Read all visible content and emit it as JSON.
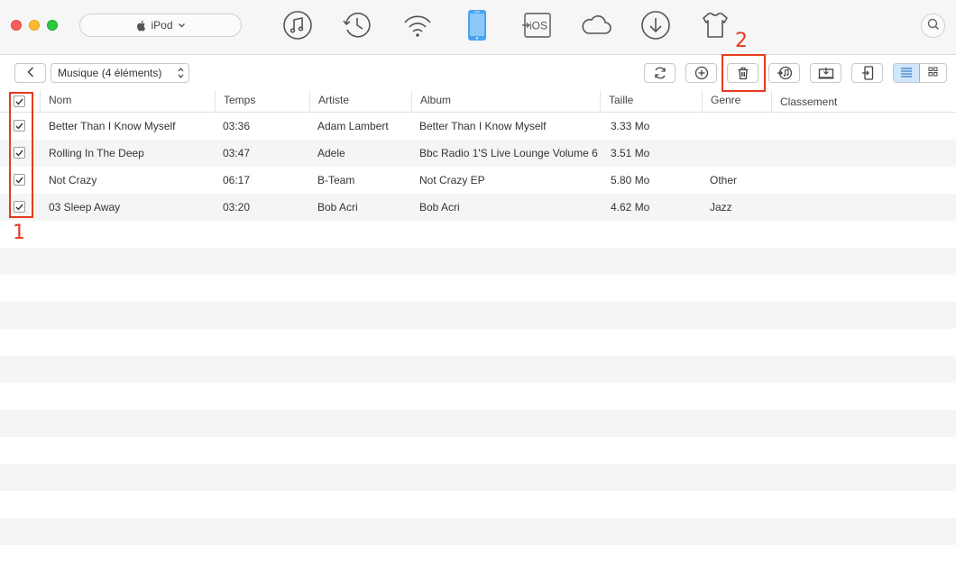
{
  "titlebar": {
    "device_name": "iPod",
    "nav_icons": [
      "music-note-icon",
      "history-clock-icon",
      "wifi-transfer-icon",
      "phone-device-icon",
      "to-ios-icon",
      "cloud-icon",
      "download-icon",
      "tshirt-icon"
    ],
    "to_ios_label": "iOS",
    "search_icon": "search-icon"
  },
  "toolbar": {
    "back_icon": "chevron-left-icon",
    "category_label": "Musique (4 éléments)",
    "actions": [
      "refresh-icon",
      "add-icon",
      "trash-icon",
      "to-itunes-icon",
      "to-computer-icon",
      "to-device-icon"
    ],
    "views": [
      "list-view-icon",
      "grid-view-icon"
    ],
    "active_view": "list"
  },
  "table": {
    "columns": {
      "name": "Nom",
      "time": "Temps",
      "artist": "Artiste",
      "album": "Album",
      "size": "Taille",
      "genre": "Genre",
      "rank": "Classement"
    },
    "header_checked": true,
    "rows": [
      {
        "checked": true,
        "name": "Better Than I Know Myself",
        "time": "03:36",
        "artist": "Adam Lambert",
        "album": "Better Than I Know Myself",
        "size": "3.33 Mo",
        "genre": ""
      },
      {
        "checked": true,
        "name": "Rolling In The Deep",
        "time": "03:47",
        "artist": "Adele",
        "album": "Bbc Radio 1'S Live Lounge Volume 6",
        "size": "3.51 Mo",
        "genre": ""
      },
      {
        "checked": true,
        "name": "Not Crazy",
        "time": "06:17",
        "artist": "B-Team",
        "album": "Not Crazy EP",
        "size": "5.80 Mo",
        "genre": "Other"
      },
      {
        "checked": true,
        "name": "03 Sleep Away",
        "time": "03:20",
        "artist": "Bob Acri",
        "album": "Bob Acri",
        "size": "4.62 Mo",
        "genre": "Jazz"
      }
    ]
  },
  "annotations": {
    "step1": "1",
    "step2": "2",
    "color": "#e63a1e"
  },
  "colors": {
    "accent": "#4aa3f0",
    "annotation": "#e63a1e",
    "row_alt": "#f5f5f5"
  }
}
